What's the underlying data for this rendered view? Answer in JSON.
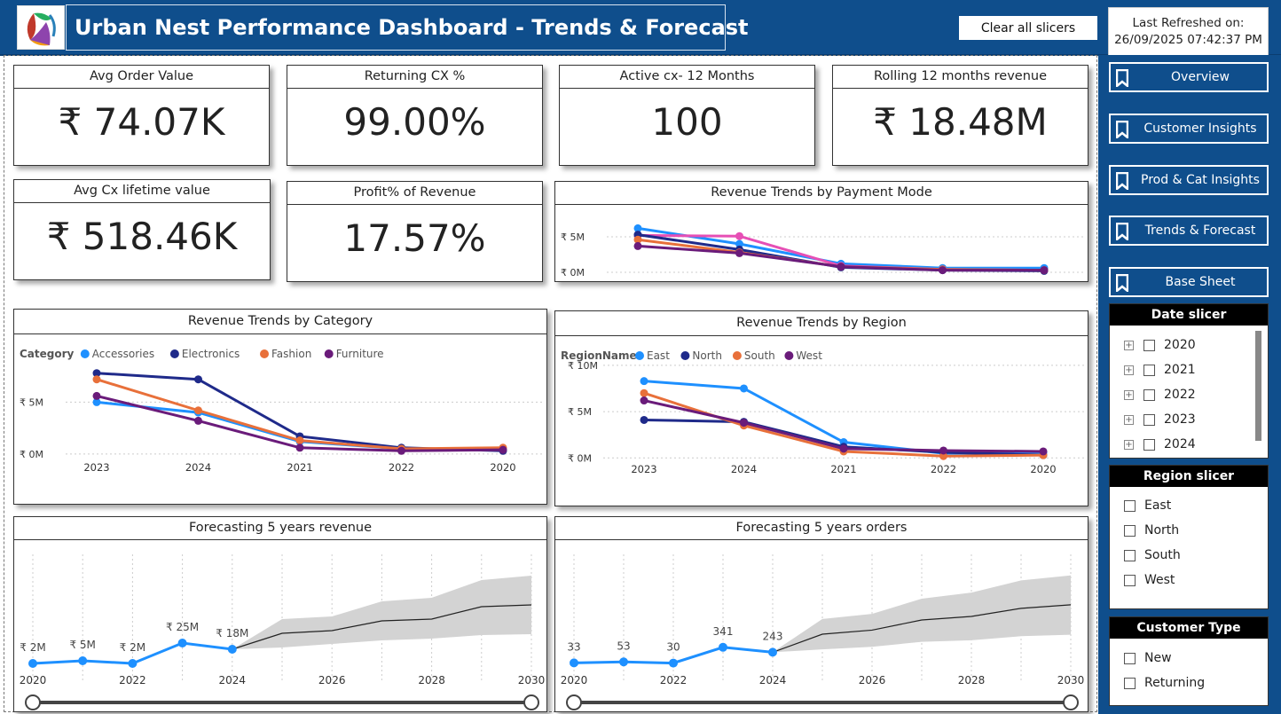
{
  "header": {
    "title": "Urban Nest Performance Dashboard - Trends & Forecast",
    "clear_label": "Clear all slicers",
    "refresh_label": "Last Refreshed on:",
    "refresh_value": "26/09/2025  07:42:37 PM"
  },
  "kpis": [
    {
      "title": "Avg Order Value",
      "value": "₹ 74.07K"
    },
    {
      "title": "Returning CX %",
      "value": "99.00%"
    },
    {
      "title": "Active cx- 12 Months",
      "value": "100"
    },
    {
      "title": "Rolling 12 months revenue",
      "value": "₹ 18.48M"
    },
    {
      "title": "Avg Cx lifetime value",
      "value": "₹ 518.46K"
    },
    {
      "title": "Profit% of Revenue",
      "value": "17.57%"
    }
  ],
  "nav": [
    {
      "label": "Overview"
    },
    {
      "label": "Customer Insights"
    },
    {
      "label": "Prod & Cat Insights"
    },
    {
      "label": "Trends & Forecast"
    },
    {
      "label": "Base Sheet"
    }
  ],
  "slicers": {
    "date": {
      "title": "Date slicer",
      "items": [
        "2020",
        "2021",
        "2022",
        "2023",
        "2024"
      ]
    },
    "region": {
      "title": "Region slicer",
      "items": [
        "East",
        "North",
        "South",
        "West"
      ]
    },
    "customer": {
      "title": "Customer Type",
      "items": [
        "New",
        "Returning"
      ]
    }
  },
  "colors": {
    "header_bg": "#0f4e8c",
    "light_blue": "#1e90ff",
    "navy": "#1f2a8a",
    "orange": "#e8703a",
    "purple": "#6a1b7a",
    "pink": "#e64fb5",
    "forecast_band": "#d3d3d3"
  },
  "chart_data": [
    {
      "type": "line",
      "title": "Revenue Trends by Payment Mode",
      "x": [
        "2023",
        "2024",
        "2021",
        "2022",
        "2020"
      ],
      "ytick_labels": [
        "₹ 0M",
        "₹ 5M"
      ],
      "yticks": [
        0,
        5
      ],
      "ylim": [
        -1,
        8.5
      ],
      "series": [
        {
          "color": "#1e90ff",
          "values": [
            6.2,
            4.0,
            1.2,
            0.6,
            0.6
          ]
        },
        {
          "color": "#e64fb5",
          "values": [
            5.2,
            5.1,
            0.9,
            0.4,
            0.3
          ]
        },
        {
          "color": "#1f2a8a",
          "values": [
            5.3,
            3.2,
            0.7,
            0.3,
            0.2
          ]
        },
        {
          "color": "#e8703a",
          "values": [
            4.6,
            2.8,
            0.8,
            0.4,
            0.3
          ]
        },
        {
          "color": "#6a1b7a",
          "values": [
            3.7,
            2.7,
            0.8,
            0.3,
            0.3
          ]
        }
      ]
    },
    {
      "type": "line",
      "title": "Revenue Trends by Category",
      "legend_label": "Category",
      "x": [
        "2023",
        "2024",
        "2021",
        "2022",
        "2020"
      ],
      "ytick_labels": [
        "₹ 0M",
        "₹ 5M"
      ],
      "yticks": [
        0,
        5
      ],
      "ylim": [
        -1.3,
        10
      ],
      "series": [
        {
          "name": "Accessories",
          "color": "#1e90ff",
          "values": [
            5.0,
            4.0,
            1.2,
            0.5,
            0.4
          ]
        },
        {
          "name": "Electronics",
          "color": "#1f2a8a",
          "values": [
            7.8,
            7.2,
            1.7,
            0.6,
            0.3
          ]
        },
        {
          "name": "Fashion",
          "color": "#e8703a",
          "values": [
            7.2,
            4.2,
            1.3,
            0.5,
            0.6
          ]
        },
        {
          "name": "Furniture",
          "color": "#6a1b7a",
          "values": [
            5.6,
            3.2,
            0.6,
            0.3,
            0.4
          ]
        }
      ]
    },
    {
      "type": "line",
      "title": "Revenue Trends by Region",
      "legend_label": "RegionName",
      "x": [
        "2023",
        "2024",
        "2021",
        "2022",
        "2020"
      ],
      "ytick_labels": [
        "₹ 0M",
        "₹ 5M",
        "₹ 10M"
      ],
      "yticks": [
        0,
        5,
        10
      ],
      "ylim": [
        -1.6,
        12
      ],
      "series": [
        {
          "name": "East",
          "color": "#1e90ff",
          "values": [
            8.3,
            7.5,
            1.7,
            0.5,
            0.6
          ]
        },
        {
          "name": "North",
          "color": "#1f2a8a",
          "values": [
            4.1,
            3.9,
            1.2,
            0.6,
            0.3
          ]
        },
        {
          "name": "South",
          "color": "#e8703a",
          "values": [
            7.0,
            3.5,
            0.7,
            0.2,
            0.3
          ]
        },
        {
          "name": "West",
          "color": "#6a1b7a",
          "values": [
            6.2,
            3.8,
            1.0,
            0.8,
            0.7
          ]
        }
      ]
    },
    {
      "type": "line",
      "title": "Forecasting 5 years revenue",
      "x": [
        2020,
        2021,
        2022,
        2023,
        2024
      ],
      "values": [
        2,
        5,
        2,
        25,
        18
      ],
      "value_labels": [
        "₹ 2M",
        "₹ 5M",
        "₹ 2M",
        "₹ 25M",
        "₹ 18M"
      ],
      "forecast_x": [
        2024,
        2025,
        2026,
        2027,
        2028,
        2029,
        2030
      ],
      "forecast": [
        18,
        36,
        39,
        50,
        52,
        66,
        68
      ],
      "forecast_lower": [
        18,
        20,
        24,
        28,
        30,
        34,
        35
      ],
      "forecast_upper": [
        18,
        52,
        55,
        72,
        76,
        96,
        101
      ],
      "xtick_labels": [
        "2020",
        "2022",
        "2024",
        "2026",
        "2028",
        "2030"
      ],
      "ylim": [
        -5,
        115
      ]
    },
    {
      "type": "line",
      "title": "Forecasting 5 years orders",
      "x": [
        2020,
        2021,
        2022,
        2023,
        2024
      ],
      "values": [
        33,
        53,
        30,
        341,
        243
      ],
      "value_labels": [
        "33",
        "53",
        "30",
        "341",
        "243"
      ],
      "forecast_x": [
        2024,
        2025,
        2026,
        2027,
        2028,
        2029,
        2030
      ],
      "forecast": [
        243,
        600,
        680,
        880,
        950,
        1110,
        1180
      ],
      "forecast_lower": [
        243,
        300,
        350,
        450,
        480,
        560,
        590
      ],
      "forecast_upper": [
        243,
        900,
        1000,
        1300,
        1420,
        1660,
        1760
      ],
      "xtick_labels": [
        "2020",
        "2022",
        "2024",
        "2026",
        "2028",
        "2030"
      ],
      "ylim": [
        -100,
        2000
      ]
    }
  ]
}
